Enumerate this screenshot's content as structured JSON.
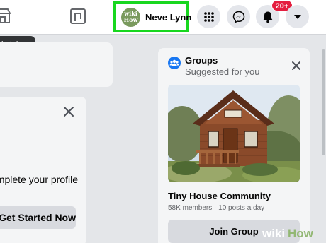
{
  "header": {
    "profile": {
      "avatar_text_1": "wiki",
      "avatar_text_2": "How",
      "name": "Neve Lynn"
    },
    "notifications": {
      "badge": "20+"
    },
    "icons": [
      "marketplace-icon",
      "gaming-icon",
      "menu-grid-icon",
      "messenger-icon",
      "bell-icon",
      "caret-down-icon"
    ]
  },
  "tooltip": {
    "text": "Marketplace"
  },
  "left_card": {
    "prompt": "Complete your profile",
    "button": "Get Started Now"
  },
  "groups": {
    "title": "Groups",
    "subtitle": "Suggested for you",
    "group_name": "Tiny House Community",
    "meta": "58K members · 10 posts a day",
    "join_button": "Join Group"
  },
  "watermark": {
    "part1": "wiki",
    "part2": "How"
  },
  "colors": {
    "highlight": "#18d71f",
    "badge": "#e41e3f",
    "facebook_blue": "#1877f2"
  }
}
